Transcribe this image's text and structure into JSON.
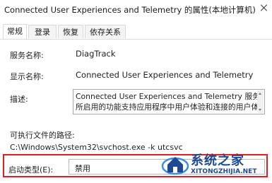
{
  "window": {
    "title": "Connected User Experiences and Telemetry 的属性(本地计算机)"
  },
  "tabs": [
    {
      "label": "常规",
      "active": true
    },
    {
      "label": "登录",
      "active": false
    },
    {
      "label": "恢复",
      "active": false
    },
    {
      "label": "依存关系",
      "active": false
    }
  ],
  "general": {
    "service_name_label": "服务名称:",
    "service_name": "DiagTrack",
    "display_name_label": "显示名称:",
    "display_name": "Connected User Experiences and Telemetry",
    "description_label": "描述:",
    "description_lines": [
      "Connected User Experiences and Telemetry 服务",
      "所启用的功能支持应用程序中用户体验和连接的用户体"
    ],
    "exe_path_label": "可执行文件的路径:",
    "exe_path": "C:\\Windows\\System32\\svchost.exe -k utcsvc",
    "startup_type_label": "启动类型(E):",
    "startup_type": "禁用"
  },
  "watermark": {
    "title": "系统之家",
    "url": "XITONGZHIJIA.NET",
    "colors": {
      "primary": "#1e4a93",
      "secondary": "#3a8ee6"
    }
  },
  "colors": {
    "highlight": "#e02020"
  }
}
